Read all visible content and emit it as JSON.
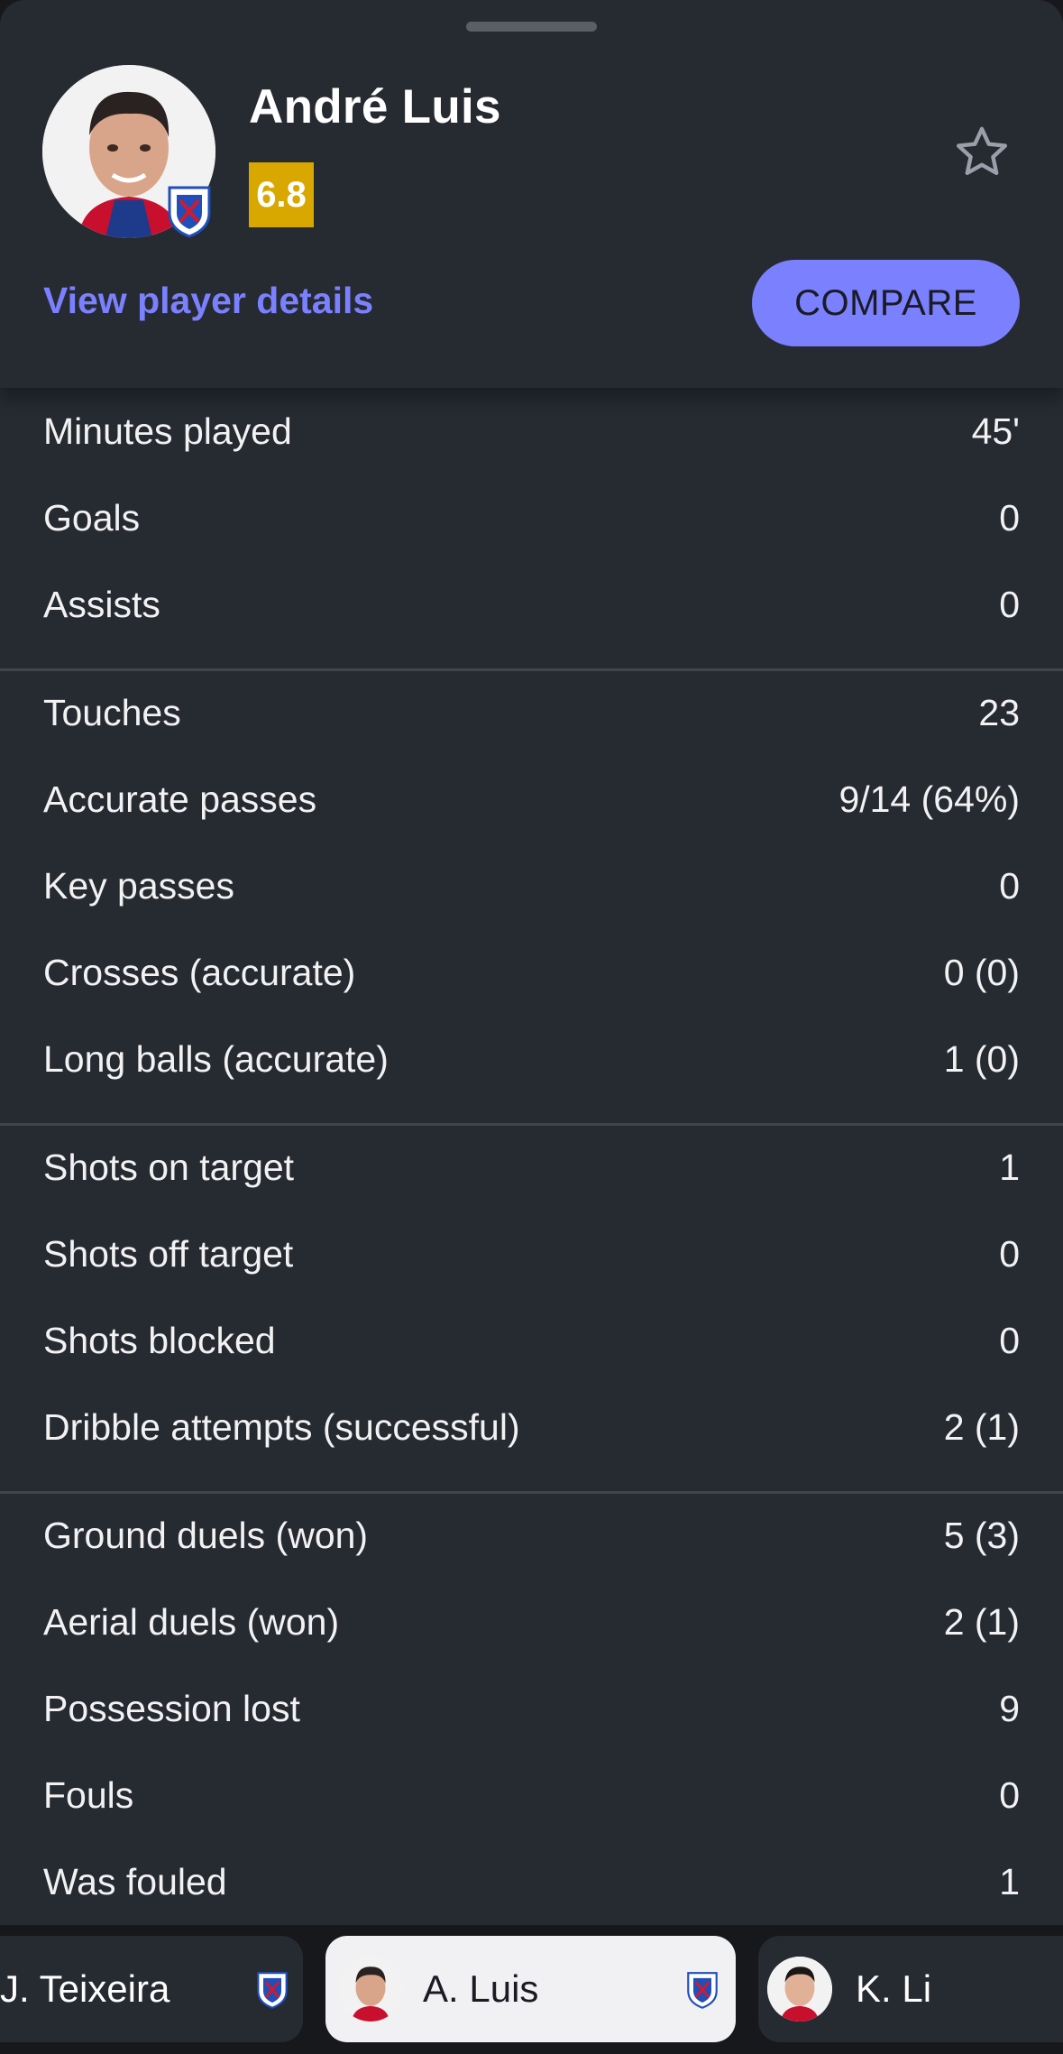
{
  "header": {
    "player_name": "André Luis",
    "rating": "6.8",
    "rating_color": "#d9a800",
    "details_link": "View player details",
    "compare_label": "COMPARE",
    "accent": "#7b80ff"
  },
  "stats": [
    {
      "label": "Minutes played",
      "value": "45'"
    },
    {
      "label": "Goals",
      "value": "0"
    },
    {
      "label": "Assists",
      "value": "0"
    },
    {
      "label": "Touches",
      "value": "23"
    },
    {
      "label": "Accurate passes",
      "value": "9/14 (64%)"
    },
    {
      "label": "Key passes",
      "value": "0"
    },
    {
      "label": "Crosses (accurate)",
      "value": "0 (0)"
    },
    {
      "label": "Long balls (accurate)",
      "value": "1 (0)"
    },
    {
      "label": "Shots on target",
      "value": "1"
    },
    {
      "label": "Shots off target",
      "value": "0"
    },
    {
      "label": "Shots blocked",
      "value": "0"
    },
    {
      "label": "Dribble attempts (successful)",
      "value": "2 (1)"
    },
    {
      "label": "Ground duels (won)",
      "value": "5 (3)"
    },
    {
      "label": "Aerial duels (won)",
      "value": "2 (1)"
    },
    {
      "label": "Possession lost",
      "value": "9"
    },
    {
      "label": "Fouls",
      "value": "0"
    },
    {
      "label": "Was fouled",
      "value": "1"
    }
  ],
  "player_switcher": [
    {
      "name": "J. Teixeira",
      "active": false
    },
    {
      "name": "A. Luis",
      "active": true
    },
    {
      "name": "K. Li",
      "active": false
    }
  ]
}
